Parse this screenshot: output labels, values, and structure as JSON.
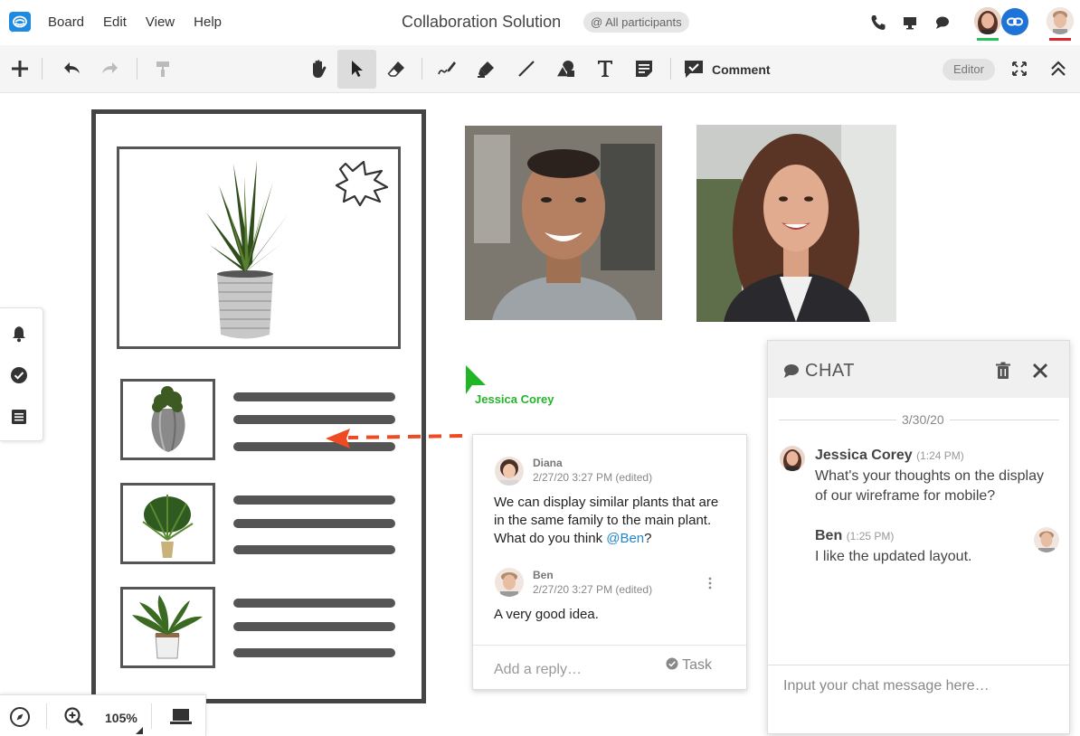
{
  "menu": {
    "items": [
      "Board",
      "Edit",
      "View",
      "Help"
    ]
  },
  "header": {
    "title": "Collaboration Solution",
    "participants_filter": "@ All participants"
  },
  "toolbar": {
    "comment_label": "Comment",
    "mode_label": "Editor"
  },
  "canvas": {
    "cursor_label": "Jessica Corey"
  },
  "comment_thread": {
    "comments": [
      {
        "author": "Diana",
        "time": "2/27/20 3:27 PM (edited)",
        "text_before": "We can display similar plants that are in the same family to the main plant. What do you think ",
        "mention": "@Ben",
        "text_after": "?"
      },
      {
        "author": "Ben",
        "time": "2/27/20 3:27 PM (edited)",
        "text": "A very good idea."
      }
    ],
    "reply_placeholder": "Add a reply…",
    "task_label": "Task"
  },
  "chat": {
    "title": "CHAT",
    "date": "3/30/20",
    "messages": [
      {
        "author": "Jessica Corey",
        "time": "(1:24 PM)",
        "text": "What's your thoughts on the display of our wireframe for mobile?"
      },
      {
        "author": "Ben",
        "time": "(1:25 PM)",
        "text": "I like the updated layout."
      }
    ],
    "input_placeholder": "Input your chat message here…"
  },
  "zoom": {
    "level": "105%"
  },
  "colors": {
    "accent": "#1e73d6",
    "cursor_green": "#22b527",
    "arrow_red": "#f04a23",
    "mention_blue": "#1f86c8"
  }
}
